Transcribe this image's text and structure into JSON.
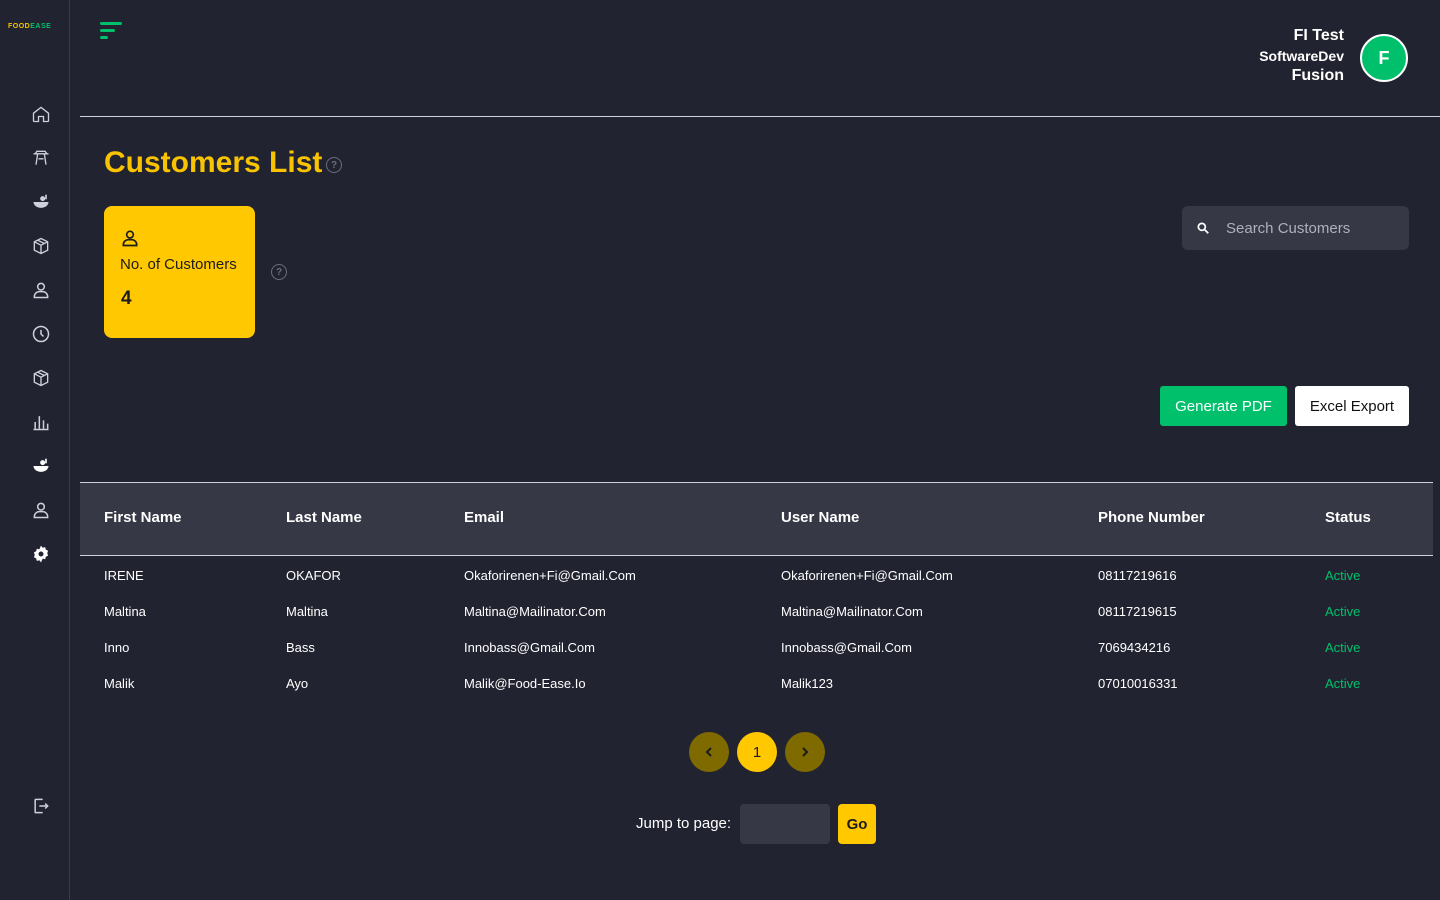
{
  "brand": {
    "logo_part1": "FOOD",
    "logo_part2": "EASE"
  },
  "user": {
    "line1": "FI Test",
    "line2": "SoftwareDev",
    "line3": "Fusion",
    "avatar_initial": "F"
  },
  "page": {
    "title": "Customers List"
  },
  "stat": {
    "label": "No. of Customers",
    "value": "4"
  },
  "search": {
    "placeholder": "Search Customers",
    "value": ""
  },
  "actions": {
    "pdf_label": "Generate PDF",
    "excel_label": "Excel Export"
  },
  "table": {
    "headers": [
      "First Name",
      "Last Name",
      "Email",
      "User Name",
      "Phone Number",
      "Status"
    ],
    "rows": [
      [
        "IRENE",
        "OKAFOR",
        "Okaforirenen+Fi@Gmail.Com",
        "Okaforirenen+Fi@Gmail.Com",
        "08117219616",
        "Active"
      ],
      [
        "Maltina",
        "Maltina",
        "Maltina@Mailinator.Com",
        "Maltina@Mailinator.Com",
        "08117219615",
        "Active"
      ],
      [
        "Inno",
        "Bass",
        "Innobass@Gmail.Com",
        "Innobass@Gmail.Com",
        "7069434216",
        "Active"
      ],
      [
        "Malik",
        "Ayo",
        "Malik@Food-Ease.Io",
        "Malik123",
        "07010016331",
        "Active"
      ]
    ]
  },
  "pagination": {
    "current_page": "1",
    "prev_icon": "chevron-left-icon",
    "next_icon": "chevron-right-icon"
  },
  "jump": {
    "label": "Jump to page:",
    "value": "",
    "go_label": "Go"
  },
  "sidebar": {
    "items": [
      {
        "icon": "home-icon"
      },
      {
        "icon": "dining-table-icon"
      },
      {
        "icon": "food-bowl-icon"
      },
      {
        "icon": "box-icon"
      },
      {
        "icon": "user-icon"
      },
      {
        "icon": "clock-icon"
      },
      {
        "icon": "package-icon"
      },
      {
        "icon": "bar-chart-icon"
      },
      {
        "icon": "food-icon"
      },
      {
        "icon": "user-icon"
      },
      {
        "icon": "settings-gear-icon"
      }
    ],
    "logout_icon": "logout-icon"
  },
  "colors": {
    "accent_yellow": "#ffc800",
    "title_yellow": "#f8c300",
    "success_green": "#00c06b",
    "background": "#222330",
    "panel": "#363846"
  }
}
